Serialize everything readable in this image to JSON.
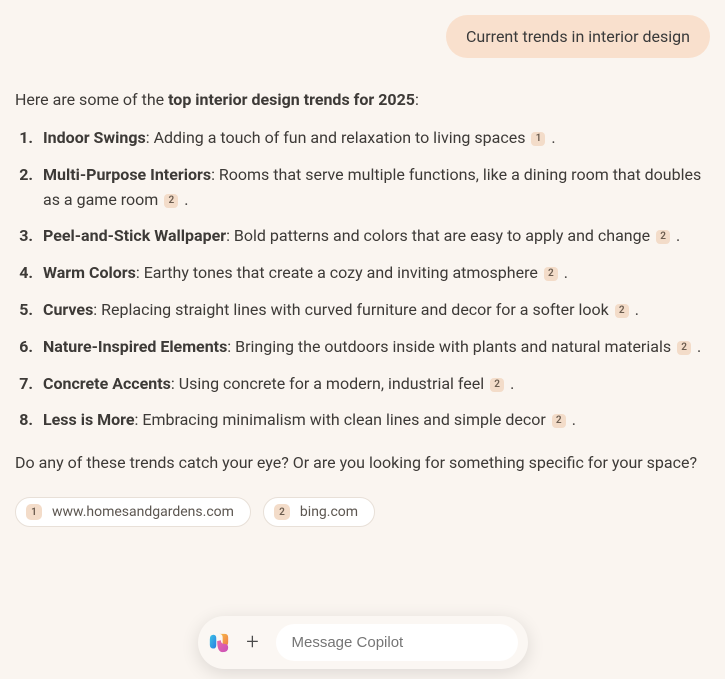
{
  "user_message": "Current trends in interior design",
  "intro_pre": "Here are some of the ",
  "intro_bold": "top interior design trends for 2025",
  "intro_post": ":",
  "trends": [
    {
      "title": "Indoor Swings",
      "desc": ": Adding a touch of fun and relaxation to living spaces",
      "cite": "1"
    },
    {
      "title": "Multi-Purpose Interiors",
      "desc": ": Rooms that serve multiple functions, like a dining room that doubles as a game room",
      "cite": "2"
    },
    {
      "title": "Peel-and-Stick Wallpaper",
      "desc": ": Bold patterns and colors that are easy to apply and change",
      "cite": "2"
    },
    {
      "title": "Warm Colors",
      "desc": ": Earthy tones that create a cozy and inviting atmosphere",
      "cite": "2"
    },
    {
      "title": "Curves",
      "desc": ": Replacing straight lines with curved furniture and decor for a softer look",
      "cite": "2"
    },
    {
      "title": "Nature-Inspired Elements",
      "desc": ": Bringing the outdoors inside with plants and natural materials",
      "cite": "2"
    },
    {
      "title": "Concrete Accents",
      "desc": ": Using concrete for a modern, industrial feel",
      "cite": "2"
    },
    {
      "title": "Less is More",
      "desc": ": Embracing minimalism with clean lines and simple decor",
      "cite": "2"
    }
  ],
  "outro": "Do any of these trends catch your eye? Or are you looking for something specific for your space?",
  "sources": [
    {
      "num": "1",
      "label": "www.homesandgardens.com"
    },
    {
      "num": "2",
      "label": "bing.com"
    }
  ],
  "composer_placeholder": "Message Copilot"
}
